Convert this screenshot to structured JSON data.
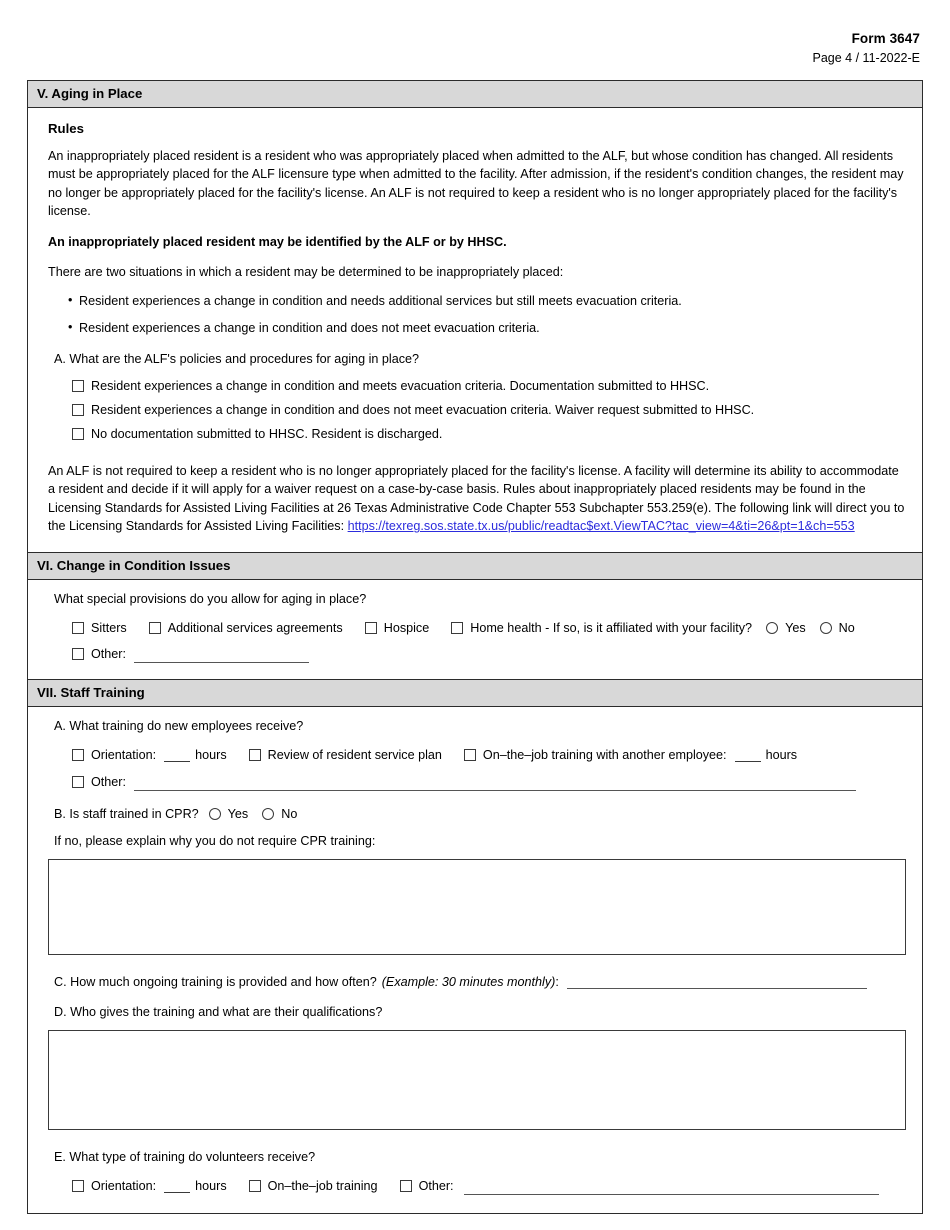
{
  "header": {
    "form_number": "Form 3647",
    "page_revision": "Page 4 / 11-2022-E"
  },
  "sections": {
    "aging_in_place": {
      "title": "V. Aging in Place",
      "rules_heading": "Rules",
      "paragraph_1": "An inappropriately placed resident is a resident who was appropriately placed when admitted to the ALF, but whose condition has changed. All residents must be appropriately placed for the ALF licensure type when admitted to the facility. After admission, if the resident's condition changes, the resident may no longer be appropriately placed for the facility's license. An ALF is not required to keep a resident who is no longer appropriately placed for the facility's license.",
      "bold_statement": "An inappropriately placed resident may be identified by the ALF or by HHSC.",
      "paragraph_2": "There are two situations in which a resident may be determined to be inappropriately placed:",
      "bullets": [
        "Resident experiences a change in condition and needs additional services but still meets evacuation criteria.",
        "Resident experiences a change in condition and does not meet evacuation criteria."
      ],
      "question_a": "A. What are the ALF's policies and procedures for aging in place?",
      "checkboxes": [
        "Resident experiences a change in condition and meets evacuation criteria. Documentation submitted to HHSC.",
        "Resident experiences a change in condition and does not meet evacuation criteria. Waiver request submitted to HHSC.",
        "No documentation submitted to HHSC. Resident is discharged."
      ],
      "paragraph_3_pre": "An ALF is not required to keep a resident who is no longer appropriately placed for the facility's license. A facility will determine its ability to accommodate a resident and decide if it will apply for a waiver request on a case-by-case basis. Rules about inappropriately placed residents may be found in the Licensing Standards for Assisted Living Facilities at 26 Texas Administrative Code Chapter 553 Subchapter 553.259(e). The following link will direct you to the Licensing Standards for Assisted Living Facilities: ",
      "link_text": "https://texreg.sos.state.tx.us/public/readtac$ext.ViewTAC?tac_view=4&ti=26&pt=1&ch=553",
      "link_color": "#2c2cdd"
    },
    "change_in_condition": {
      "title": "VI. Change in Condition Issues",
      "question": "What special provisions do you allow for aging in place?",
      "option_sitters": "Sitters",
      "option_additional_services": "Additional services agreements",
      "option_hospice": "Hospice",
      "option_home_health": "Home health - If so, is it affiliated with your facility?",
      "radio_yes": "Yes",
      "radio_no": "No",
      "option_other": "Other:"
    },
    "staff_training": {
      "title": "VII. Staff Training",
      "question_a": "A. What training do new employees receive?",
      "a_orientation": "Orientation:",
      "a_hours_1": "hours",
      "a_review_plan": "Review of resident service plan",
      "a_on_the_job": "On–the–job training with another employee:",
      "a_hours_2": "hours",
      "a_other": "Other:",
      "question_b": "B. Is staff trained in CPR?",
      "b_radio_yes": "Yes",
      "b_radio_no": "No",
      "b_followup": "If no, please explain why you do not require CPR training:",
      "question_c_main": "C. How much ongoing training is provided and how often?",
      "question_c_example": "(Example: 30 minutes monthly)",
      "question_c_colon": ":",
      "question_d": "D. Who gives the training and what are their qualifications?",
      "question_e": "E. What type of training do volunteers receive?",
      "e_orientation": "Orientation:",
      "e_hours": "hours",
      "e_on_the_job": "On–the–job training",
      "e_other": "Other:"
    }
  }
}
